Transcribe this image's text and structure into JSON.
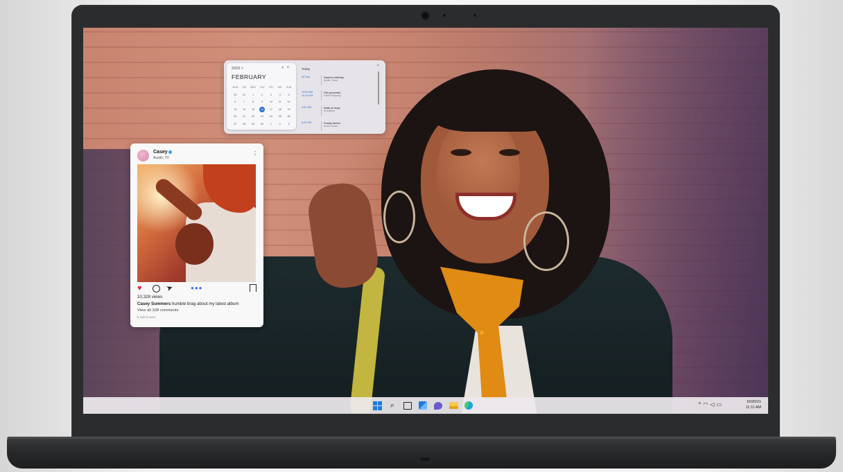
{
  "calendar": {
    "year_label": "2023 ˅",
    "month": "FEBRUARY",
    "search_icon": "search-icon",
    "add_icon": "plus-icon",
    "weekdays": [
      "MON",
      "TUE",
      "WED",
      "THU",
      "FRI",
      "SAT",
      "SUN"
    ],
    "days": [
      "30",
      "31",
      "1",
      "2",
      "3",
      "4",
      "5",
      "6",
      "7",
      "8",
      "9",
      "10",
      "11",
      "12",
      "13",
      "14",
      "15",
      "16",
      "17",
      "18",
      "19",
      "20",
      "21",
      "22",
      "23",
      "24",
      "25",
      "26",
      "27",
      "28",
      "29",
      "30",
      "1",
      "2",
      "3"
    ],
    "selected_day": "16",
    "agenda_header": "Today",
    "agenda": [
      {
        "time": "All Day",
        "title": "Sarah's birthday",
        "subtitle": "Austin, Texas"
      },
      {
        "time": "10:00 AM\n10:15 PM",
        "title": "Get groceries",
        "subtitle": "Online shopping"
      },
      {
        "time": "3:00 PM",
        "title": "Walk w/ dogs",
        "subtitle": "Downtown"
      },
      {
        "time": "8:00 PM",
        "title": "Family dinner",
        "subtitle": "Mom's house"
      }
    ]
  },
  "post": {
    "user": "Casey",
    "location": "Austin, TX",
    "views": "10,328 views",
    "caption_user": "Casey Summers",
    "caption_text": " humble brag about my latest album",
    "comments_link": "View all 328 comments",
    "posted": "5 DAYS AGO",
    "liked": true
  },
  "taskbar": {
    "icons": [
      "windows-start-icon",
      "search-icon",
      "task-view-icon",
      "widgets-icon",
      "chat-icon",
      "file-explorer-icon",
      "edge-browser-icon"
    ],
    "tray_icons": [
      "chevron-up-icon",
      "wifi-icon",
      "speaker-icon",
      "battery-icon"
    ],
    "date": "10/20/21",
    "time": "11:11 AM"
  },
  "colors": {
    "accent": "#2a6fd3",
    "like": "#e0263a",
    "laptop_body": "#2b2c2e"
  }
}
